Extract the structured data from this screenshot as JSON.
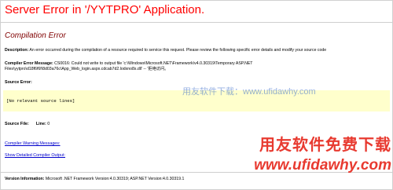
{
  "page": {
    "app_title": "Server Error in '/YYTPRO' Application.",
    "section_title": "Compilation Error"
  },
  "description": {
    "label": "Description:",
    "text": "An error occurred during the compilation of a resource required to service this request. Please review the following specific error details and modify your source code"
  },
  "compiler_error": {
    "label": "Compiler Error Message:",
    "line1": "CS0016: Could not write to output file 'c:\\Windows\\Microsoft.NET\\Framework\\v4.0.30319\\Temporary ASP.NET",
    "line2": "Files\\yytpro\\d18f6f6f\\8d03a76c\\App_Web_login.aspx.cdcab7d2.lodxno8s.dll' -- '拒绝访问。"
  },
  "source_error": {
    "label": "Source Error:",
    "code": "[No relevant source lines]"
  },
  "source_file": {
    "label": "Source File:",
    "line_label": "Line:",
    "line_value": "0"
  },
  "links": {
    "warnings": "Compiler Warning Messages:",
    "details": "Show Detailed Compiler Output:"
  },
  "version": {
    "label": "Version Information:",
    "text": "Microsoft .NET Framework Version:4.0.30319; ASP.NET Version:4.0.30319.1"
  },
  "watermarks": {
    "center": "用友软件下载：www.ufidawhy.com",
    "logo_line1": "用友软件免费下载",
    "logo_line2": "www.ufidawhy.com"
  },
  "colors": {
    "app_title": "#ff0000",
    "section_title": "#800000",
    "code_background": "#ffffcc",
    "link": "#0000cc",
    "watermark_logo": "#e83a30"
  }
}
